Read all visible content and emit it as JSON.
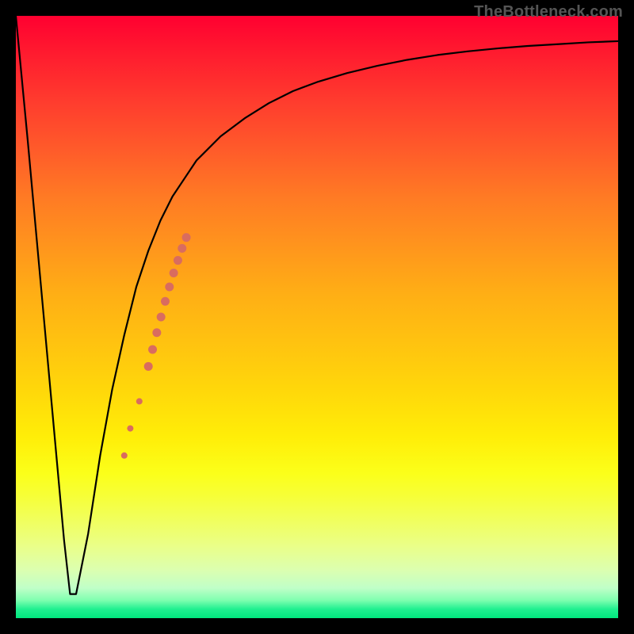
{
  "watermark": "TheBottleneck.com",
  "colors": {
    "background_frame": "#000000",
    "curve_stroke": "#000000",
    "marker_fill": "#d96c5f",
    "gradient_top": "#ff0030",
    "gradient_mid": "#ffd000",
    "gradient_bottom": "#00e77e"
  },
  "chart_data": {
    "type": "line",
    "title": "",
    "xlabel": "",
    "ylabel": "",
    "xlim": [
      0,
      100
    ],
    "ylim": [
      0,
      100
    ],
    "grid": false,
    "legend": false,
    "series": [
      {
        "name": "bottleneck-curve",
        "x": [
          0,
          2,
          4,
          6,
          8,
          9,
          10,
          12,
          14,
          16,
          18,
          20,
          22,
          24,
          26,
          28,
          30,
          34,
          38,
          42,
          46,
          50,
          55,
          60,
          65,
          70,
          75,
          80,
          85,
          90,
          95,
          100
        ],
        "values": [
          100,
          79,
          57,
          35,
          13,
          4,
          4,
          14,
          27,
          38,
          47,
          55,
          61,
          66,
          70,
          73,
          76,
          80,
          83,
          85.5,
          87.5,
          89,
          90.5,
          91.7,
          92.7,
          93.5,
          94.1,
          94.6,
          95.0,
          95.3,
          95.6,
          95.8
        ]
      }
    ],
    "markers": {
      "name": "highlight-segment",
      "color": "#d96c5f",
      "points": [
        {
          "x": 18.0,
          "y": 27.0,
          "r": 4.0
        },
        {
          "x": 19.0,
          "y": 31.5,
          "r": 4.0
        },
        {
          "x": 20.5,
          "y": 36.0,
          "r": 4.0
        },
        {
          "x": 22.0,
          "y": 41.8,
          "r": 5.5
        },
        {
          "x": 22.7,
          "y": 44.6,
          "r": 5.5
        },
        {
          "x": 23.4,
          "y": 47.4,
          "r": 5.5
        },
        {
          "x": 24.1,
          "y": 50.0,
          "r": 5.5
        },
        {
          "x": 24.8,
          "y": 52.6,
          "r": 5.5
        },
        {
          "x": 25.5,
          "y": 55.0,
          "r": 5.5
        },
        {
          "x": 26.2,
          "y": 57.3,
          "r": 5.5
        },
        {
          "x": 26.9,
          "y": 59.4,
          "r": 5.5
        },
        {
          "x": 27.6,
          "y": 61.4,
          "r": 5.5
        },
        {
          "x": 28.3,
          "y": 63.2,
          "r": 5.5
        }
      ]
    }
  }
}
